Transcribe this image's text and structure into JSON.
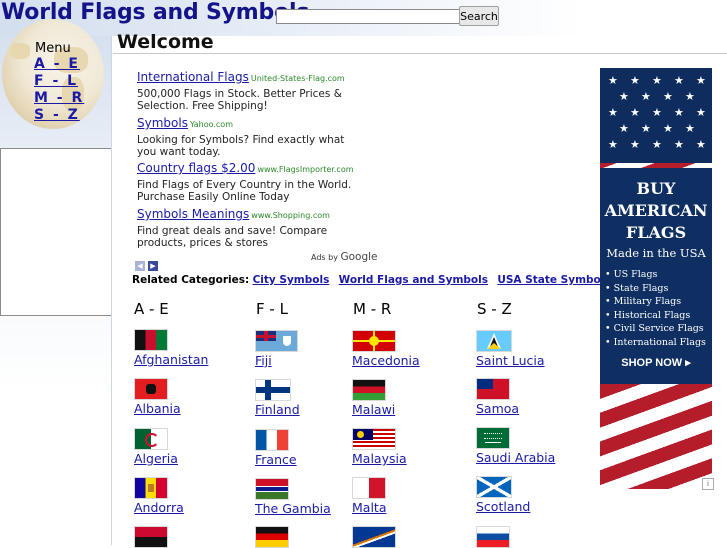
{
  "header": {
    "site_title": "World Flags and Symbols",
    "search_placeholder": "",
    "search_button": "Search"
  },
  "sidebar": {
    "menu_title": "Menu",
    "links": [
      "A - E",
      "F - L",
      "M - R",
      "S - Z"
    ]
  },
  "main": {
    "title": "Welcome"
  },
  "ads": [
    {
      "title": "International Flags",
      "domain": "United-States-Flag.com",
      "desc": "500,000 Flags in Stock. Better Prices & Selection. Free Shipping!"
    },
    {
      "title": "Symbols",
      "domain": "Yahoo.com",
      "desc": "Looking for Symbols? Find exactly what you want today."
    },
    {
      "title": "Country flags $2.00",
      "domain": "www.FlagsImporter.com",
      "desc": "Find Flags of Every Country in the World. Purchase Easily Online Today"
    },
    {
      "title": "Symbols Meanings",
      "domain": "www.Shopping.com",
      "desc": "Find great deals and save! Compare products, prices & stores"
    }
  ],
  "ads_by": {
    "prefix": "Ads by",
    "brand": "Google"
  },
  "related": {
    "label": "Related Categories:",
    "links": [
      "City Symbols",
      "World Flags and Symbols",
      "USA State Symbols"
    ]
  },
  "columns": [
    {
      "heading": "A - E",
      "countries": [
        "Afghanistan",
        "Albania",
        "Algeria",
        "Andorra",
        ""
      ]
    },
    {
      "heading": "F - L",
      "countries": [
        "Fiji",
        "Finland",
        "France",
        "The Gambia",
        ""
      ]
    },
    {
      "heading": "M - R",
      "countries": [
        "Macedonia",
        "Malawi",
        "Malaysia",
        "Malta",
        ""
      ]
    },
    {
      "heading": "S - Z",
      "countries": [
        "Saint Lucia",
        "Samoa",
        "Saudi Arabia",
        "Scotland",
        ""
      ]
    }
  ],
  "banner": {
    "headline_1": "BUY",
    "headline_2": "AMERICAN",
    "headline_3": "FLAGS",
    "made": "Made in the USA",
    "items": [
      "US Flags",
      "State Flags",
      "Military Flags",
      "Historical Flags",
      "Civil Service Flags",
      "International Flags"
    ],
    "cta": "SHOP NOW ▸"
  },
  "colors": {
    "link": "#1a1aa6",
    "title": "#14148a",
    "ad_domain": "#2a8a2a",
    "ad_nav": "#3a4a9a"
  }
}
